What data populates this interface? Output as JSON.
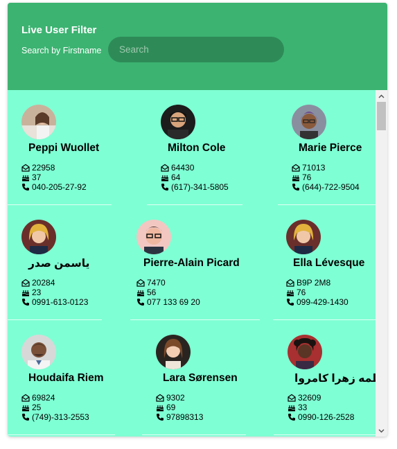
{
  "header": {
    "title": "Live User Filter",
    "search_label": "Search by Firstname",
    "search_placeholder": "Search",
    "search_value": ""
  },
  "colors": {
    "header_bg": "#3cb371",
    "search_bg": "#2e8b57",
    "list_bg": "#7fffd4"
  },
  "icons": {
    "zip": "envelope-open-icon",
    "age": "birthday-cake-icon",
    "phone": "phone-icon"
  },
  "users": [
    {
      "name": "Peppi Wuollet",
      "zip": "22958",
      "age": "37",
      "phone": "040-205-27-92"
    },
    {
      "name": "Milton Cole",
      "zip": "64430",
      "age": "64",
      "phone": "(617)-341-5805"
    },
    {
      "name": "Marie Pierce",
      "zip": "71013",
      "age": "76",
      "phone": "(644)-722-9504"
    },
    {
      "name": "یاسمن صدر",
      "zip": "20284",
      "age": "23",
      "phone": "0991-613-0123"
    },
    {
      "name": "Pierre-Alain Picard",
      "zip": "7470",
      "age": "56",
      "phone": "077 133 69 20"
    },
    {
      "name": "Ella Lévesque",
      "zip": "B9P 2M8",
      "age": "76",
      "phone": "099-429-1430"
    },
    {
      "name": "Houdaifa Riem",
      "zip": "69824",
      "age": "25",
      "phone": "(749)-313-2553"
    },
    {
      "name": "Lara Sørensen",
      "zip": "9302",
      "age": "69",
      "phone": "97898313"
    },
    {
      "name": "فاطمه زهرا کامروا",
      "zip": "32609",
      "age": "33",
      "phone": "0990-126-2528"
    }
  ]
}
